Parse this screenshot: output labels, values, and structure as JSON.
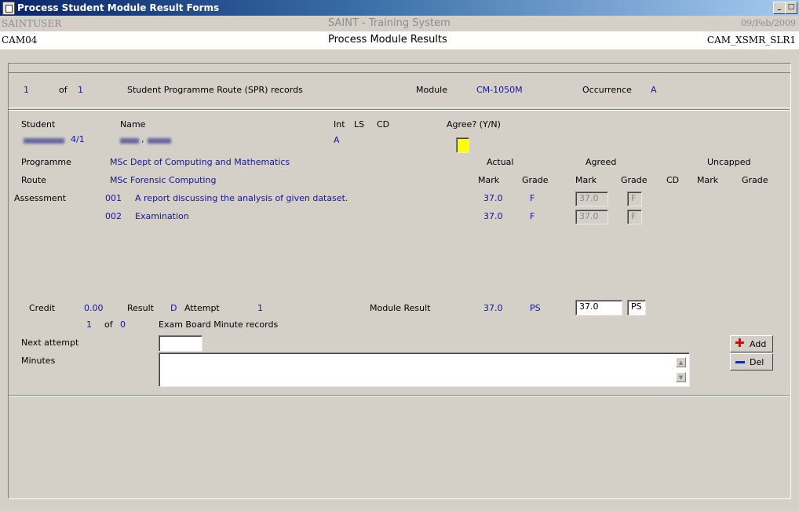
{
  "window": {
    "title": "Process Student Module Result Forms",
    "min": "_",
    "max": "□"
  },
  "header": {
    "user": "SAINTUSER",
    "system": "SAINT - Training System",
    "date": "09/Feb/2009",
    "form_code": "CAM04",
    "form_title": "Process Module Results",
    "form_id": "CAM_XSMR_SLR1"
  },
  "spr": {
    "current": "1",
    "of_label": "of",
    "total": "1",
    "records_label": "Student Programme Route (SPR) records",
    "module_label": "Module",
    "module_value": "CM-1050M",
    "occurrence_label": "Occurrence",
    "occurrence_value": "A"
  },
  "student": {
    "student_label": "Student",
    "name_label": "Name",
    "int_label": "Int",
    "ls_label": "LS",
    "cd_label": "CD",
    "agree_label": "Agree? (Y/N)",
    "student_value": "4/1",
    "name_value": ",",
    "int_value": "A",
    "programme_label": "Programme",
    "programme_value": "MSc Dept of Computing and Mathematics",
    "route_label": "Route",
    "route_value": "MSc Forensic Computing",
    "actual_label": "Actual",
    "agreed_label": "Agreed",
    "uncapped_label": "Uncapped",
    "mark_label": "Mark",
    "grade_label": "Grade",
    "cd_col_label": "CD",
    "assessment_label": "Assessment"
  },
  "assessments": [
    {
      "code": "001",
      "desc": "A report discussing the analysis of given dataset.",
      "mark": "37.0",
      "grade": "F",
      "agreed_mark": "37.0",
      "agreed_grade": "F"
    },
    {
      "code": "002",
      "desc": "Examination",
      "mark": "37.0",
      "grade": "F",
      "agreed_mark": "37.0",
      "agreed_grade": "F"
    }
  ],
  "result": {
    "credit_label": "Credit",
    "credit_value": "0.00",
    "result_label": "Result",
    "result_value": "D",
    "attempt_label": "Attempt",
    "attempt_value": "1",
    "module_result_label": "Module Result",
    "module_mark": "37.0",
    "module_grade": "PS",
    "agreed_mark": "37.0",
    "agreed_grade": "PS"
  },
  "minutes": {
    "current": "1",
    "of_label": "of",
    "total": "0",
    "records_label": "Exam Board Minute records",
    "next_attempt_label": "Next attempt",
    "next_attempt_value": "",
    "minutes_label": "Minutes",
    "minutes_value": "",
    "add_label": "Add",
    "del_label": "Del"
  },
  "colors": {
    "label_blue": "#1414a0",
    "agree_yellow": "#ffff00",
    "add_red": "#e00000",
    "del_blue": "#0030c0"
  }
}
